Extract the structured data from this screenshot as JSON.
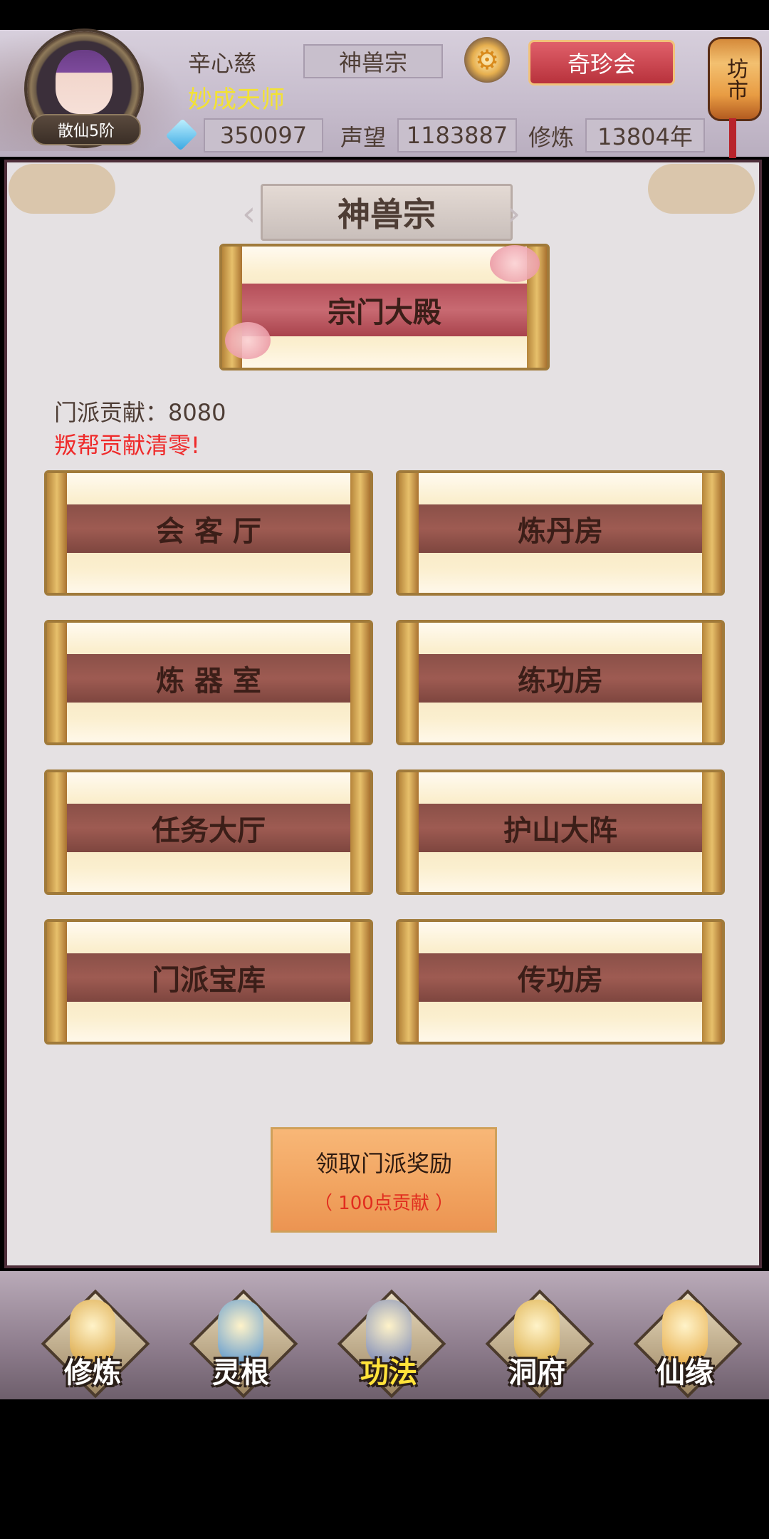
{
  "header": {
    "player_name": "辛心慈",
    "player_title": "妙成天师",
    "rank": "散仙5阶",
    "sect": "神兽宗",
    "treasure_button": "奇珍会",
    "market_button": "坊市",
    "gems": "350097",
    "prestige_label": "声望",
    "prestige_value": "1183887",
    "cultivation_label": "修炼",
    "cultivation_value": "13804年"
  },
  "main": {
    "sect_title": "神兽宗",
    "hall_button": "宗门大殿",
    "contribution": "门派贡献：8080",
    "warning": "叛帮贡献清零!",
    "buildings": [
      "会 客 厅",
      "炼丹房",
      "炼 器 室",
      "练功房",
      "任务大厅",
      "护山大阵",
      "门派宝库",
      "传功房"
    ],
    "reward_button": {
      "line1": "领取门派奖励",
      "line2": "（ 100点贡献 ）"
    }
  },
  "bottom_nav": {
    "items": [
      "修炼",
      "灵根",
      "功法",
      "洞府",
      "仙缘"
    ],
    "active": "功法",
    "colors": [
      "#d79f3a",
      "#4d8fd0",
      "#6f7fb6",
      "#d7a53a",
      "#e3a339"
    ]
  },
  "colors": {
    "warning_red": "#ef2a2a",
    "title_yellow": "#f3e233",
    "reward_orange": "#f1a35f",
    "panel_bg": "#e5e1e3"
  }
}
